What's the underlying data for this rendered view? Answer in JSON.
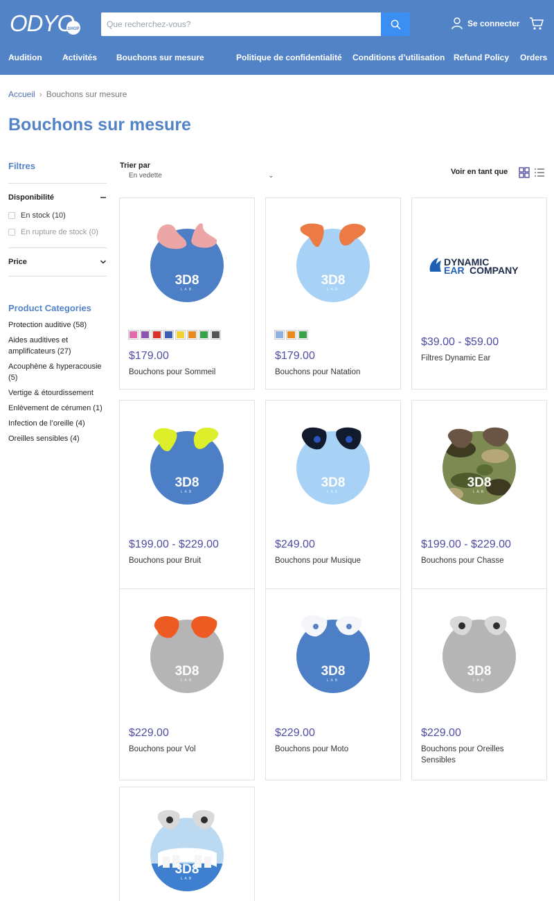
{
  "header": {
    "logo_text": "ODYO",
    "logo_sub": "SHOP",
    "search_placeholder": "Que recherchez-vous?",
    "account_label": "Se connecter",
    "colors": {
      "header_bg": "#5383c7",
      "search_button": "#3b8ef2",
      "price": "#4e4ca3"
    }
  },
  "nav": {
    "items": [
      {
        "label": "Audition",
        "dropdown": true
      },
      {
        "label": "Activités",
        "dropdown": true
      },
      {
        "label": "Bouchons sur mesure",
        "dropdown": false
      },
      {
        "label": "Politique de confidentialité",
        "dropdown": false
      },
      {
        "label": "Conditions d’utilisation",
        "dropdown": false
      },
      {
        "label": "Refund Policy",
        "dropdown": false
      },
      {
        "label": "Orders",
        "dropdown": false
      }
    ]
  },
  "breadcrumb": {
    "home": "Accueil",
    "separator": "›",
    "current": "Bouchons sur mesure"
  },
  "page_title": "Bouchons sur mesure",
  "sidebar": {
    "filters_title": "Filtres",
    "availability": {
      "title": "Disponibilité",
      "options": [
        {
          "label": "En stock (10)"
        },
        {
          "label": "En rupture de stock (0)"
        }
      ]
    },
    "price_title": "Price",
    "categories_title": "Product Categories",
    "categories": [
      "Protection auditive (58)",
      "Aides auditives et amplificateurs (27)",
      "Acouphène & hyperacousie (5)",
      "Vertige & étourdissement",
      "Enlèvement de cérumen (1)",
      "Infection de l’oreille (4)",
      "Oreilles sensibles (4)"
    ]
  },
  "toolbar": {
    "sort_label": "Trier par",
    "sort_value": "En vedette",
    "view_as_label": "Voir en tant que"
  },
  "products": [
    {
      "name": "Bouchons pour Sommeil",
      "price": "$179.00",
      "image": "pink-earplugs-blue-circle",
      "swatches": [
        "#e26bab",
        "#8a56b0",
        "#d8312a",
        "#3d5fb5",
        "#f0d234",
        "#e98a1f",
        "#39a24a",
        "#555555"
      ]
    },
    {
      "name": "Bouchons pour Natation",
      "price": "$179.00",
      "image": "orange-earplugs-lightblue-circle",
      "swatches": [
        "#8fb2e2",
        "#e9891f",
        "#39a24a"
      ]
    },
    {
      "name": "Filtres Dynamic Ear",
      "price": "$39.00 - $59.00",
      "image": "dynamic-ear-logo",
      "logo_line1": "DYNAMIC",
      "logo_line2a": "EAR",
      "logo_line2b": "COMPANY",
      "swatches": []
    },
    {
      "name": "Bouchons pour Bruit",
      "price": "$199.00 - $229.00",
      "image": "yellow-earplugs-blue-circle",
      "swatches": []
    },
    {
      "name": "Bouchons pour Musique",
      "price": "$249.00",
      "image": "black-earplugs-lightblue-circle",
      "swatches": []
    },
    {
      "name": "Bouchons pour Chasse",
      "price": "$199.00 - $229.00",
      "image": "brown-earplugs-camo-circle",
      "swatches": []
    },
    {
      "name": "Bouchons pour Vol",
      "price": "$229.00",
      "image": "orange-earplugs-grey-circle",
      "swatches": []
    },
    {
      "name": "Bouchons pour Moto",
      "price": "$229.00",
      "image": "white-earplugs-blue-circle",
      "swatches": []
    },
    {
      "name": "Bouchons pour Oreilles Sensibles",
      "price": "$229.00",
      "image": "grey-earplugs-grey-circle",
      "swatches": []
    },
    {
      "name": "",
      "price": "",
      "image": "grey-earplugs-dental-circle",
      "swatches": []
    }
  ],
  "badge_text": "3D8",
  "badge_sub": "LAB"
}
